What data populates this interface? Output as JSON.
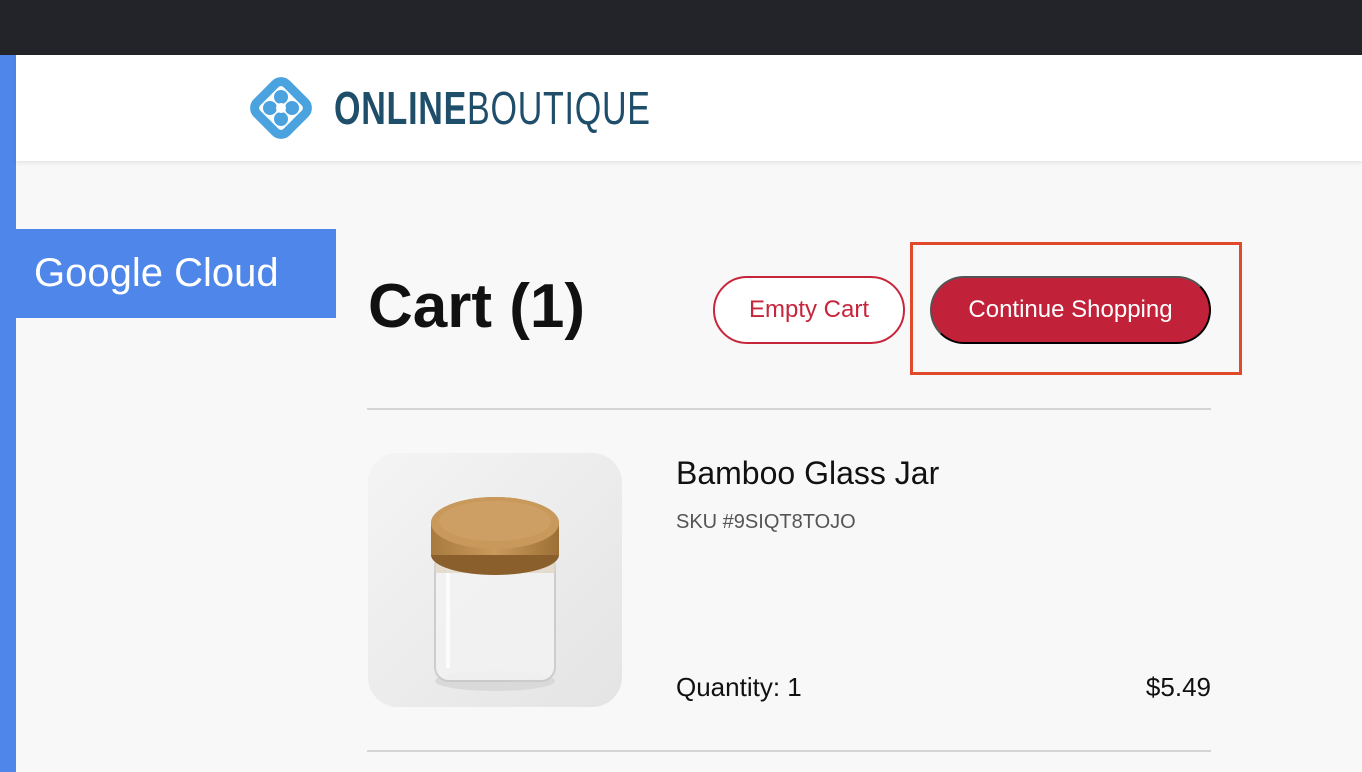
{
  "brand": {
    "logo_bold": "ONLINE",
    "logo_light": "BOUTIQUE",
    "logo_icon": "online-boutique-logo-icon",
    "primary_color": "#1f4e6b",
    "logo_icon_color": "#4aa3df"
  },
  "badge": {
    "label": "Google Cloud",
    "color": "#4f86ea"
  },
  "cart": {
    "title": "Cart (1)",
    "empty_button": "Empty Cart",
    "continue_button": "Continue Shopping",
    "accent_color": "#c1223a",
    "items": [
      {
        "name": "Bamboo Glass Jar",
        "sku": "SKU #9SIQT8TOJO",
        "quantity": "Quantity: 1",
        "price": "$5.49",
        "image_icon": "bamboo-glass-jar-image"
      }
    ]
  }
}
